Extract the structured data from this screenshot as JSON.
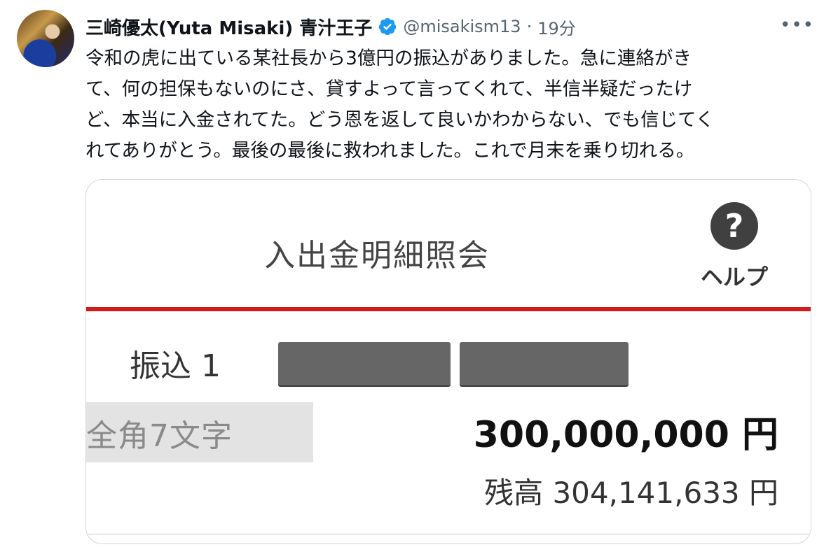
{
  "user": {
    "display_name": "三崎優太(Yuta Misaki) 青汁王子",
    "handle": "@misakism13",
    "separator": "·",
    "time": "19分",
    "verified_color": "#1d9bf0"
  },
  "menu": {
    "more_glyph": "•••"
  },
  "tweet": {
    "lines": [
      "令和の虎に出ている某社長から3億円の振込がありました。急に連絡がき",
      "て、何の担保もないのにさ、貸すよって言ってくれて、半信半疑だったけ",
      "ど、本当に入金されてた。どう恩を返して良いかわからない、でも信じてく",
      "れてありがとう。最後の最後に救われました。これで月末を乗り切れる。"
    ]
  },
  "screenshot": {
    "title": "入出金明細照会",
    "help_glyph": "?",
    "help_label": "ヘルプ",
    "transfer_label": "振込 1",
    "name_placeholder": "全角7文字",
    "amount": "300,000,000 円",
    "balance": "残高 304,141,633 円",
    "accent_color": "#d21c1c"
  }
}
